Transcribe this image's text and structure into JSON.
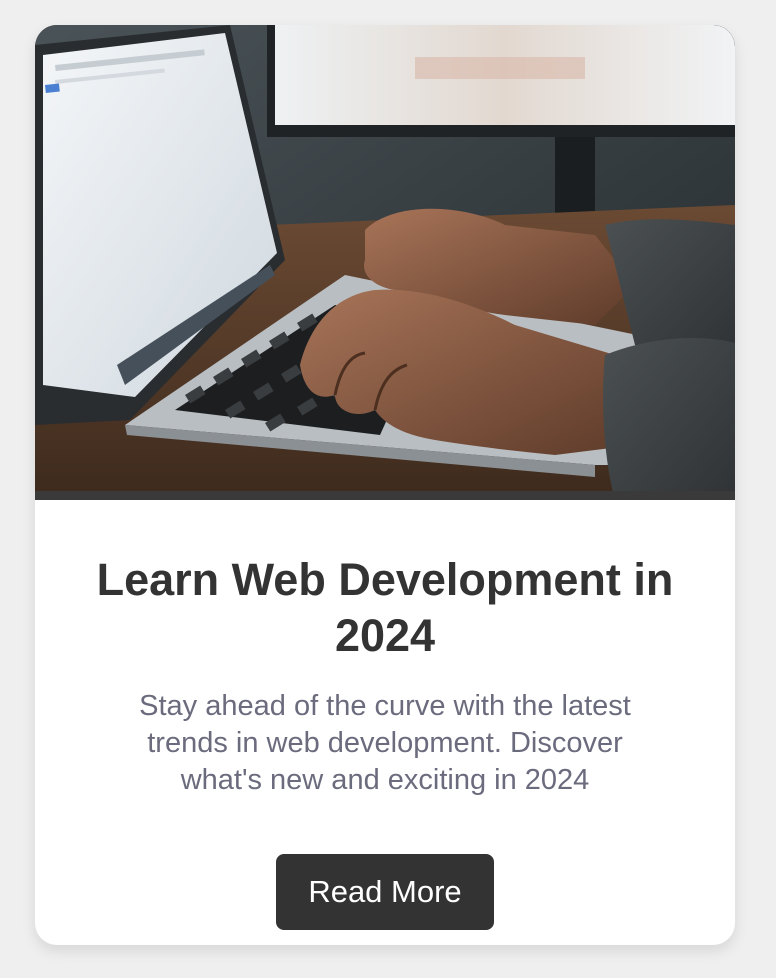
{
  "card": {
    "image_icon": "laptop-typing-photo",
    "title": "Learn Web Development in 2024",
    "description": "Stay ahead of the curve with the latest trends in web development. Discover what's new and exciting in 2024",
    "button_label": "Read More"
  },
  "colors": {
    "page_background": "#efefef",
    "card_background": "#ffffff",
    "title_text": "#333333",
    "description_text": "#6b6b7e",
    "button_background": "#333333",
    "button_text": "#ffffff"
  }
}
